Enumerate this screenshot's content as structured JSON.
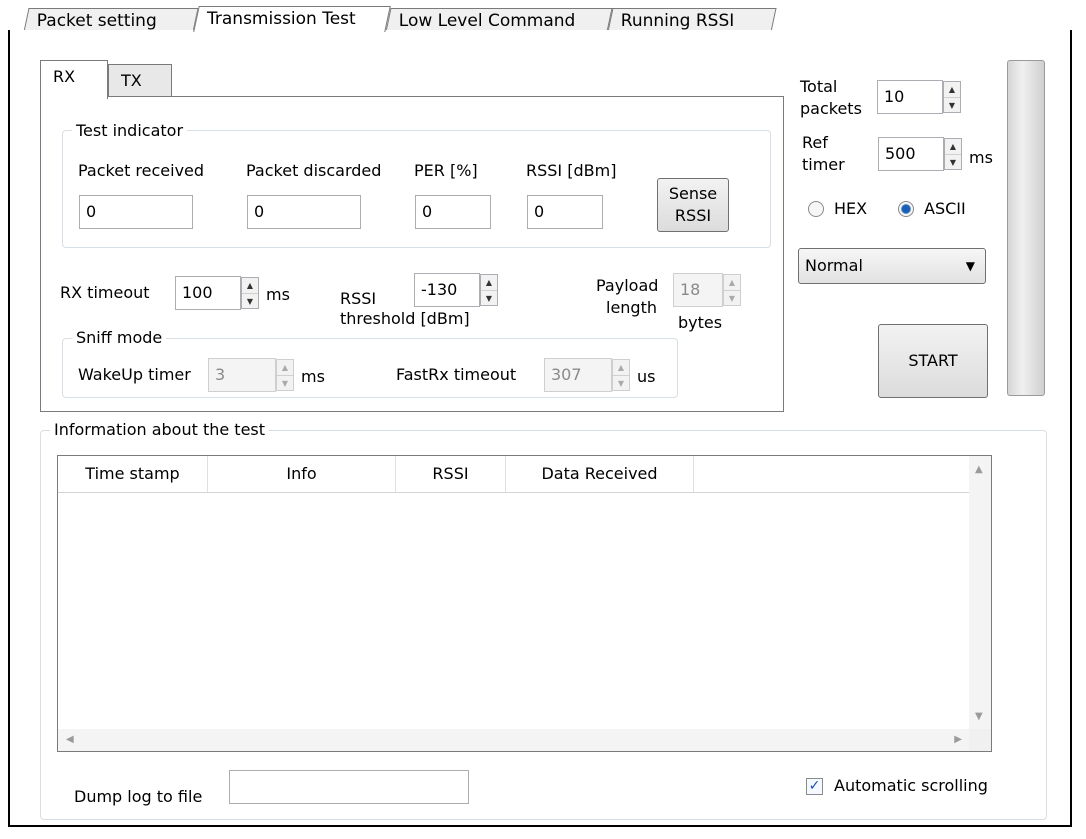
{
  "main_tabs": [
    {
      "label": "Packet setting",
      "active": false
    },
    {
      "label": "Transmission Test",
      "active": true
    },
    {
      "label": "Low Level Command",
      "active": false
    },
    {
      "label": "Running RSSI",
      "active": false
    }
  ],
  "sub_tabs": [
    {
      "label": "RX",
      "active": true
    },
    {
      "label": "TX",
      "active": false
    }
  ],
  "test_indicator": {
    "title": "Test indicator",
    "packet_received_label": "Packet received",
    "packet_received_value": "0",
    "packet_discarded_label": "Packet discarded",
    "packet_discarded_value": "0",
    "per_label": "PER [%]",
    "per_value": "0",
    "rssi_label": "RSSI [dBm]",
    "rssi_value": "0",
    "sense_rssi_line1": "Sense",
    "sense_rssi_line2": "RSSI"
  },
  "rx_settings": {
    "rx_timeout_label": "RX timeout",
    "rx_timeout_value": "100",
    "rx_timeout_unit": "ms",
    "rssi_threshold_label1": "RSSI",
    "rssi_threshold_label2": "threshold [dBm]",
    "rssi_threshold_value": "-130",
    "payload_label1": "Payload",
    "payload_label2": "length",
    "payload_value": "18",
    "payload_unit": "bytes"
  },
  "sniff_mode": {
    "title": "Sniff mode",
    "wakeup_label": "WakeUp timer",
    "wakeup_value": "3",
    "wakeup_unit": "ms",
    "fastrx_label": "FastRx timeout",
    "fastrx_value": "307",
    "fastrx_unit": "us"
  },
  "right_panel": {
    "total_label1": "Total",
    "total_label2": "packets",
    "total_value": "10",
    "ref_label1": "Ref",
    "ref_label2": "timer",
    "ref_value": "500",
    "ref_unit": "ms",
    "hex_label": "HEX",
    "ascii_label": "ASCII",
    "format_selected": "ASCII",
    "mode_selected": "Normal",
    "start_label": "START"
  },
  "info": {
    "title": "Information about the test",
    "columns": [
      "Time stamp",
      "Info",
      "RSSI",
      "Data Received"
    ],
    "dump_label": "Dump log to file",
    "dump_value": "",
    "auto_scroll_label": "Automatic scrolling",
    "auto_scroll_checked": true
  },
  "colors": {
    "accent": "#1a5fb4",
    "border": "#7a7a7a"
  }
}
